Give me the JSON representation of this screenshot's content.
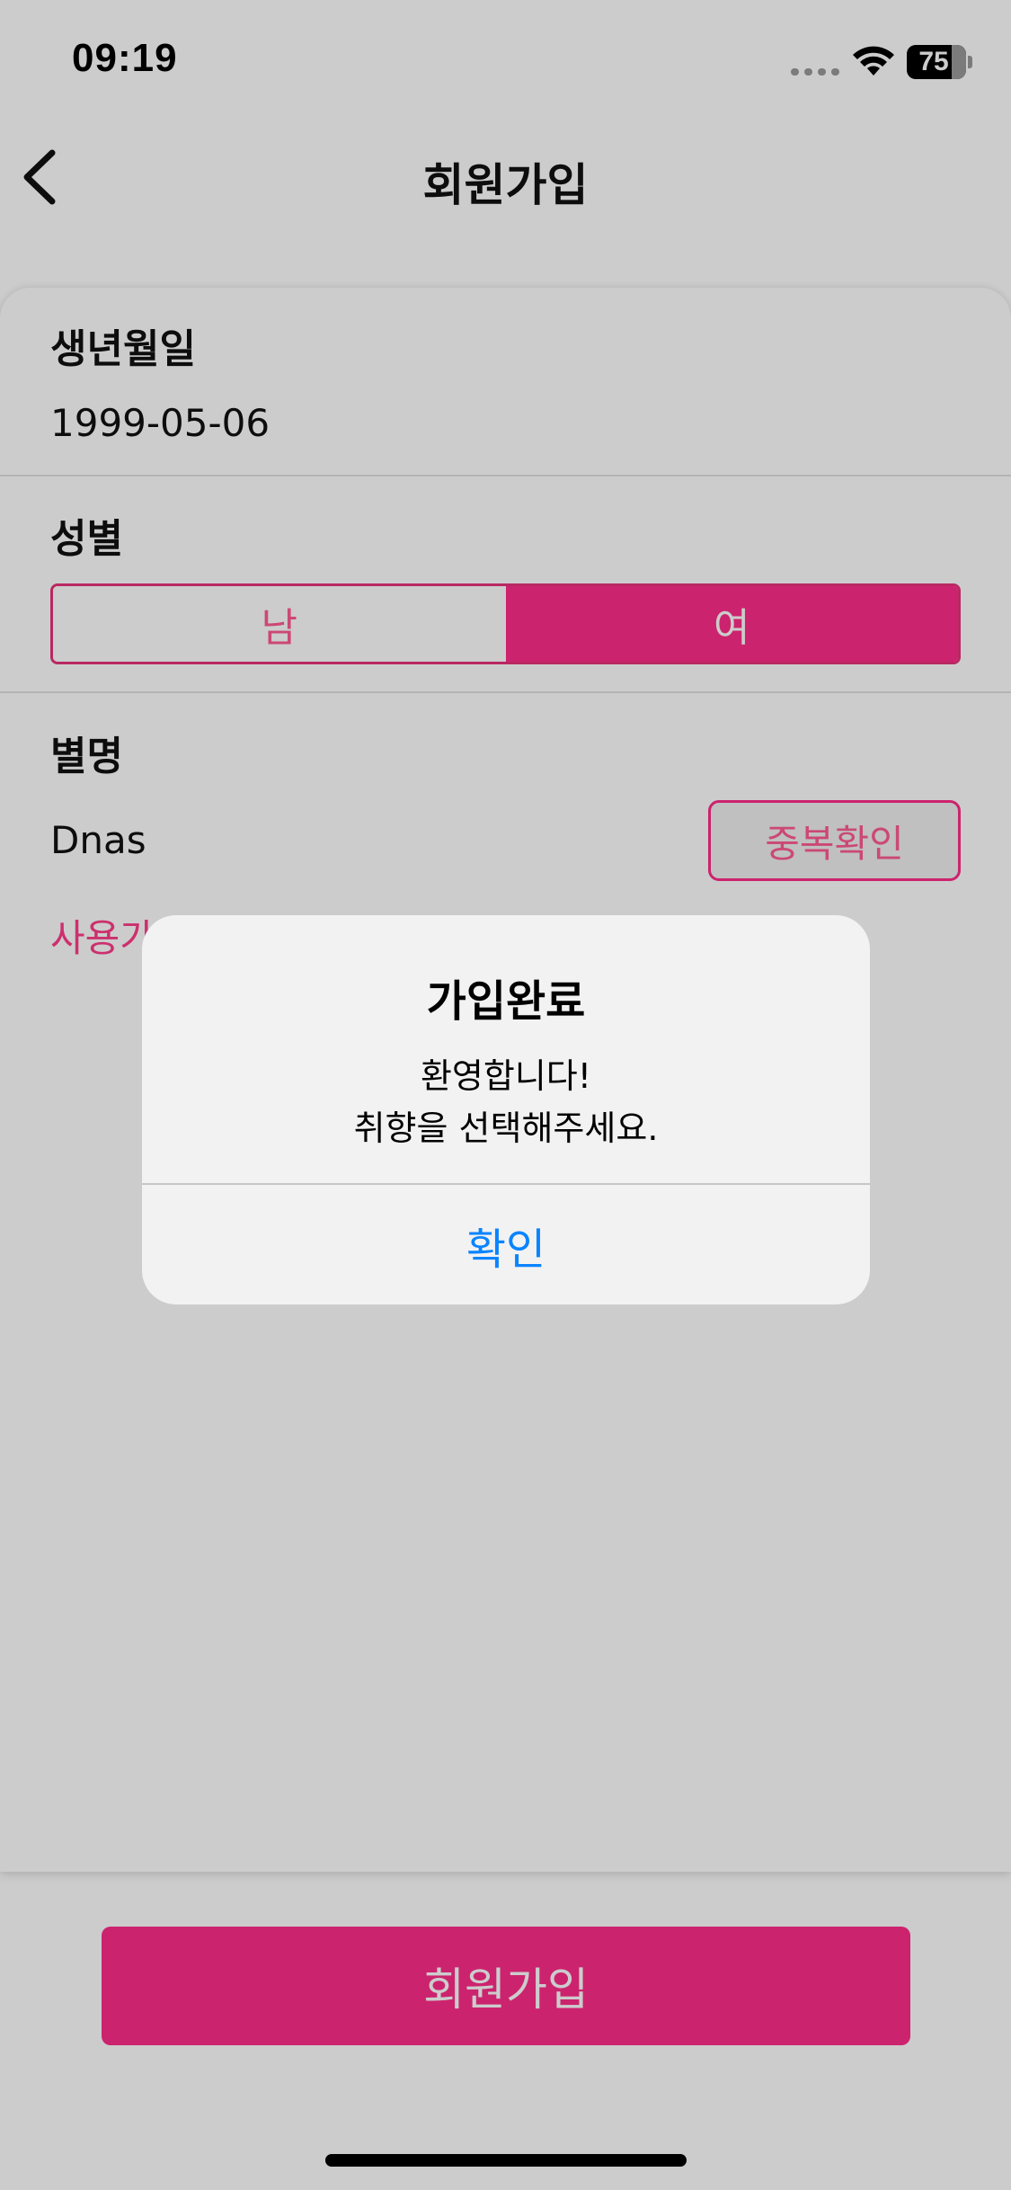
{
  "status_bar": {
    "time": "09:19",
    "battery_level": "75",
    "icons": [
      "cellular-signal-icon",
      "wifi-icon",
      "battery-icon"
    ]
  },
  "nav": {
    "title": "회원가입",
    "back_icon": "chevron-left-icon"
  },
  "form": {
    "birth_label": "생년월일",
    "birth_value": "1999-05-06",
    "gender_label": "성별",
    "gender_options": [
      "남",
      "여"
    ],
    "gender_selected": "여",
    "nickname_label": "별명",
    "nickname_value": "Dnas",
    "dup_check_label": "중복확인",
    "availability_text": "사용가"
  },
  "signup_button_label": "회원가입",
  "alert": {
    "title": "가입완료",
    "message_lines": [
      "환영합니다!",
      "취향을 선택해주세요."
    ],
    "confirm_label": "확인"
  },
  "colors": {
    "accent_pink": "#ff2c8a",
    "alert_button_blue": "#0a84ff",
    "dim_overlay": "rgba(0,0,0,0.2)"
  }
}
